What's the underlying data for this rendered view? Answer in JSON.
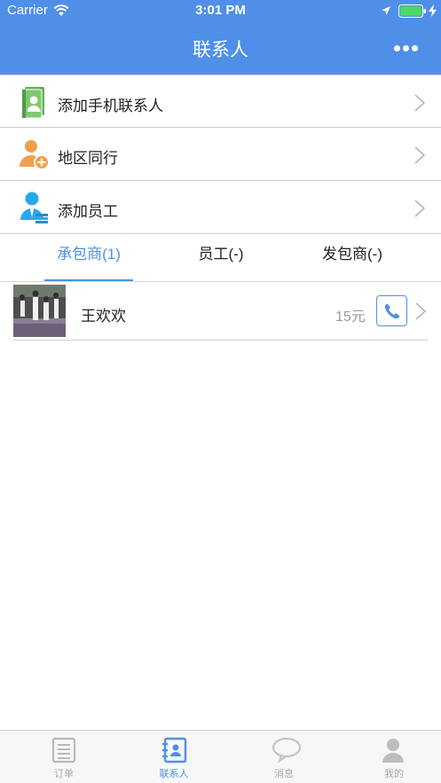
{
  "status_bar": {
    "carrier": "Carrier",
    "time": "3:01 PM"
  },
  "nav": {
    "title": "联系人"
  },
  "menu": [
    {
      "label": "添加手机联系人",
      "icon": "contacts-book-icon"
    },
    {
      "label": "地区同行",
      "icon": "add-person-icon"
    },
    {
      "label": "添加员工",
      "icon": "employee-icon"
    }
  ],
  "tabs": [
    {
      "label": "承包商(1)",
      "active": true
    },
    {
      "label": "员工(-)",
      "active": false
    },
    {
      "label": "发包商(-)",
      "active": false
    }
  ],
  "contacts": [
    {
      "name": "王欢欢",
      "price": "15元"
    }
  ],
  "tabbar": [
    {
      "label": "订单",
      "icon": "document-icon",
      "active": false
    },
    {
      "label": "联系人",
      "icon": "contacts-icon",
      "active": true
    },
    {
      "label": "消息",
      "icon": "chat-bubble-icon",
      "active": false
    },
    {
      "label": "我的",
      "icon": "person-icon",
      "active": false
    }
  ],
  "colors": {
    "accent": "#4f8fe8",
    "green": "#5fb35a",
    "orange": "#f0a04b",
    "cyan": "#2aa9e8"
  }
}
